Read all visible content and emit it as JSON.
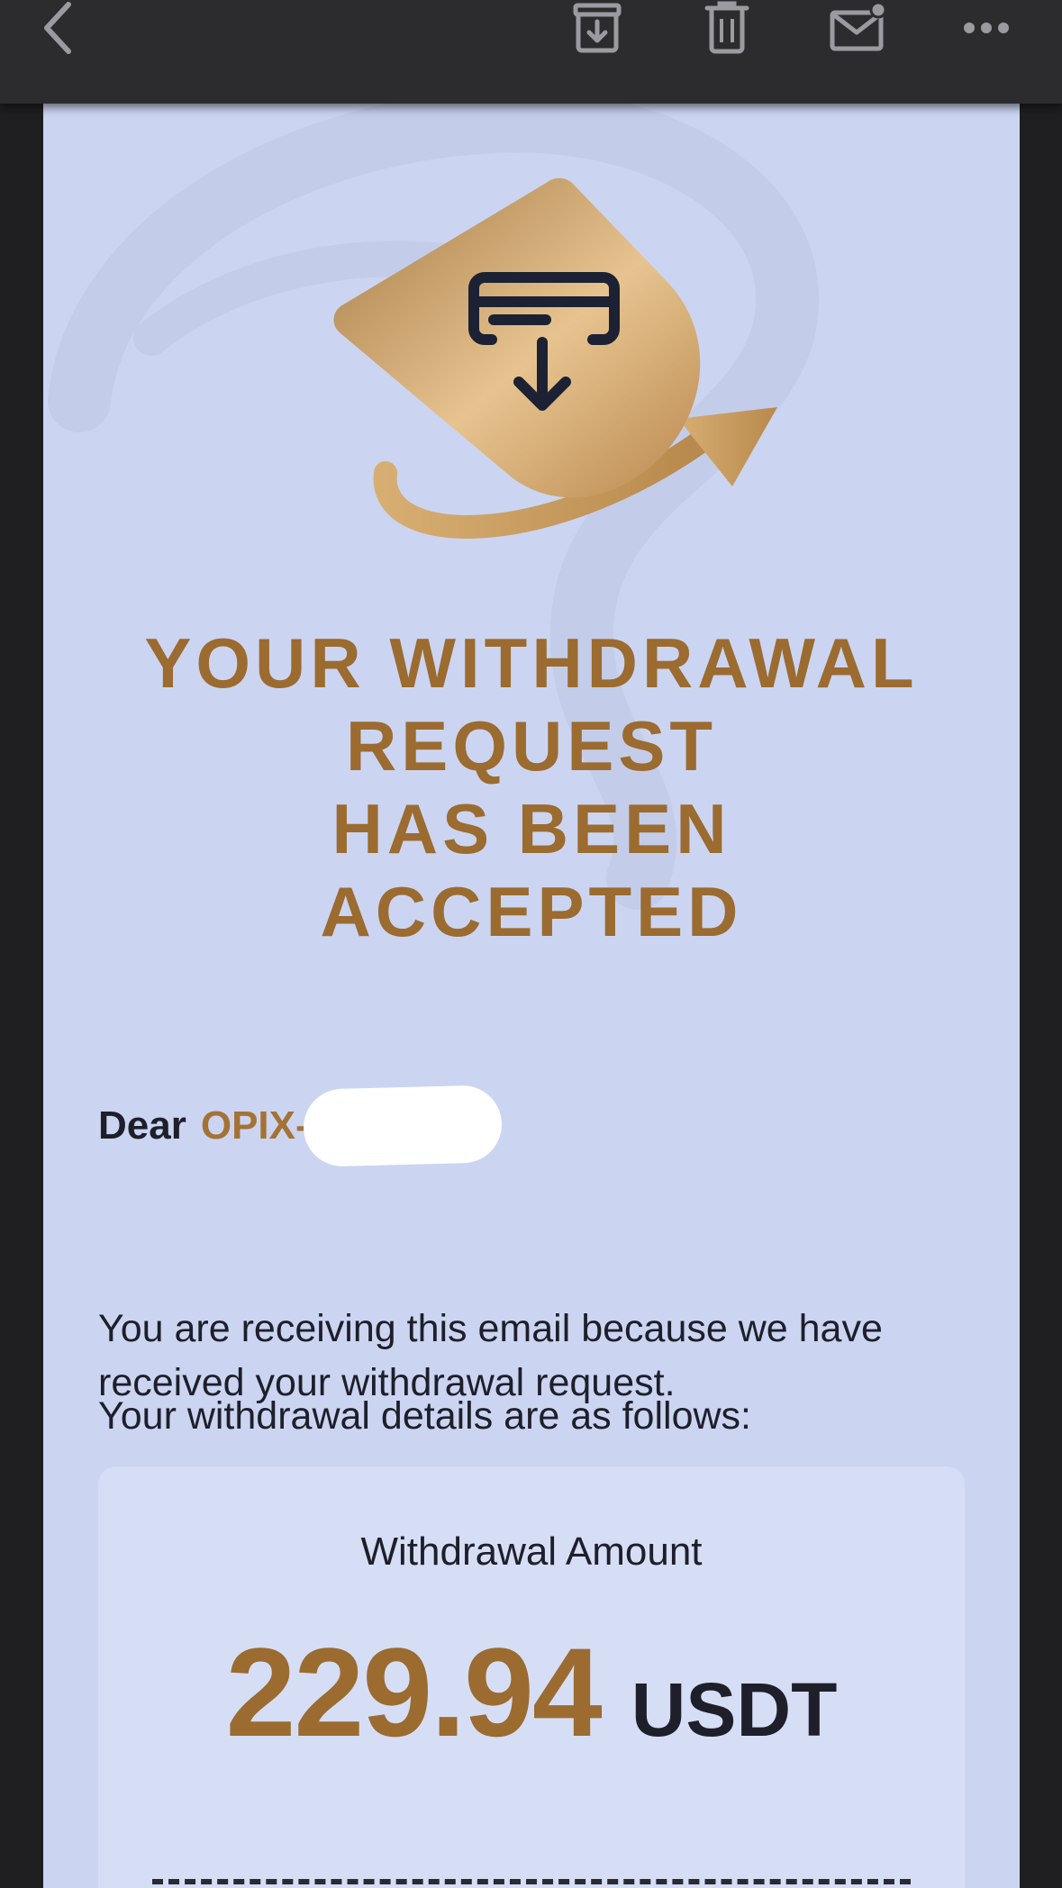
{
  "toolbar": {
    "back_icon": "chevron-left-icon",
    "archive_icon": "archive-icon",
    "trash_icon": "trash-icon",
    "mark_unread_icon": "mail-unread-icon",
    "more_icon": "more-horizontal-icon"
  },
  "email": {
    "hero_icon": "card-withdraw-icon",
    "headline": [
      "YOUR WITHDRAWAL",
      "REQUEST",
      "HAS BEEN",
      "ACCEPTED"
    ],
    "greeting_prefix": "Dear",
    "greeting_name": "OPIX-",
    "paragraph_1": "You are receiving this email because we have received your withdrawal request.",
    "paragraph_2": "Your withdrawal details are as follows:",
    "amount_card": {
      "label": "Withdrawal Amount",
      "amount": "229.94",
      "currency": "USDT"
    }
  },
  "colors": {
    "gold": "#9b6b30",
    "email_background": "#cbd5f2",
    "card_background": "#d6def6",
    "toolbar": "#2c2c2f"
  }
}
